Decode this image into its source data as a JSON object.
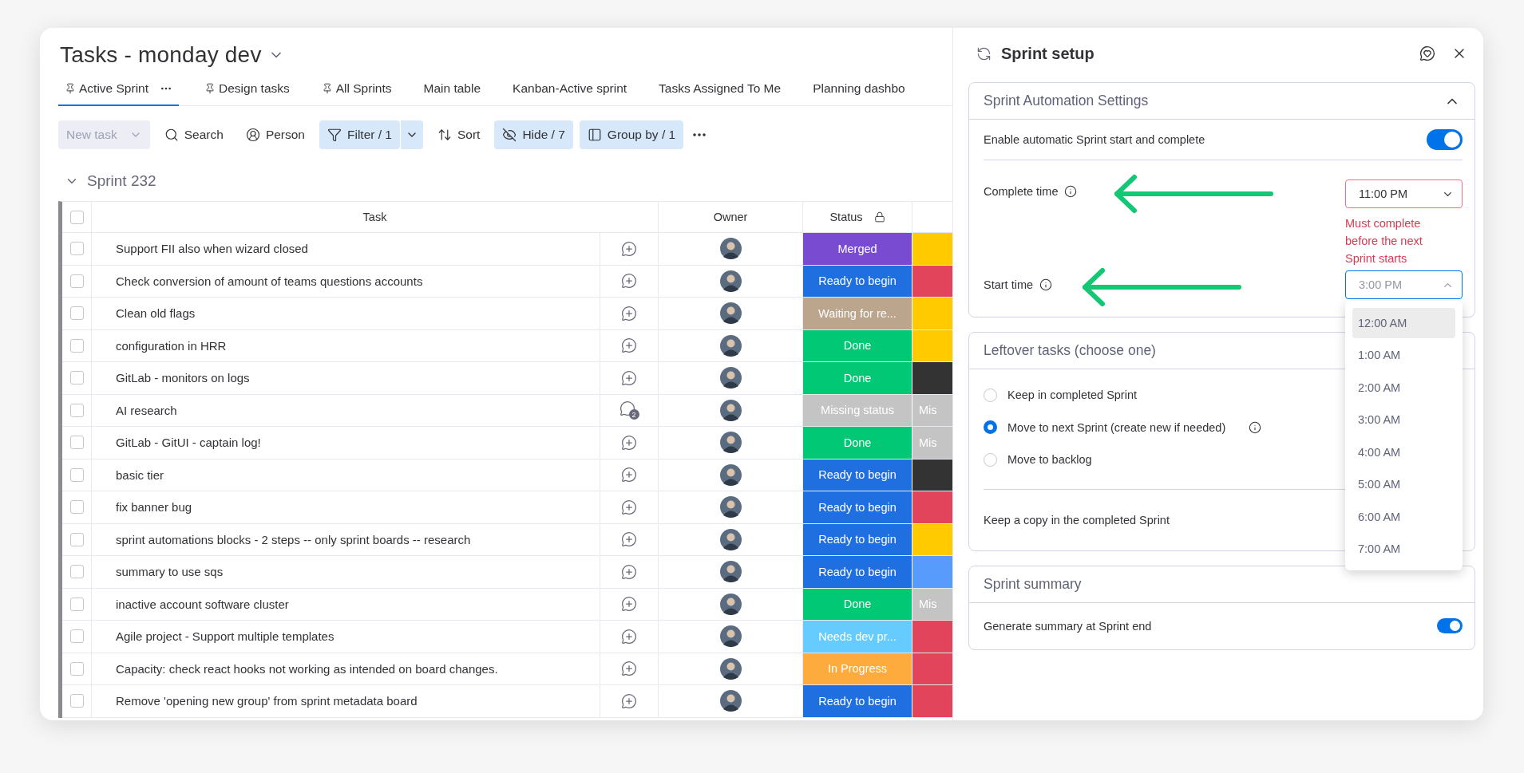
{
  "board": {
    "title": "Tasks - monday dev",
    "views": [
      {
        "label": "Active Sprint",
        "pinned": true,
        "selected": true
      },
      {
        "label": "Design tasks",
        "pinned": true,
        "selected": false
      },
      {
        "label": "All Sprints",
        "pinned": true,
        "selected": false
      },
      {
        "label": "Main table",
        "pinned": false,
        "selected": false
      },
      {
        "label": "Kanban-Active sprint",
        "pinned": false,
        "selected": false
      },
      {
        "label": "Tasks Assigned To Me",
        "pinned": false,
        "selected": false
      },
      {
        "label": "Planning dashbo",
        "pinned": false,
        "selected": false
      }
    ],
    "toolbar": [
      {
        "kind": "new",
        "label": "New task",
        "disabled": true
      },
      {
        "kind": "search",
        "label": "Search",
        "active": false
      },
      {
        "kind": "person",
        "label": "Person",
        "active": false
      },
      {
        "kind": "filter",
        "label": "Filter / 1",
        "active": true
      },
      {
        "kind": "sort",
        "label": "Sort",
        "active": false
      },
      {
        "kind": "hide",
        "label": "Hide / 7",
        "active": true
      },
      {
        "kind": "group",
        "label": "Group by / 1",
        "active": true
      },
      {
        "kind": "more"
      }
    ],
    "group": {
      "title": "Sprint 232",
      "expanded": true
    },
    "table": {
      "columns": [
        {
          "label": "Task",
          "locked": false
        },
        {
          "label": "Owner",
          "locked": false
        },
        {
          "label": "Status",
          "locked": true
        }
      ],
      "all_checked": false,
      "rows": [
        {
          "task": "Support FII also when wizard closed",
          "checked": false,
          "status": {
            "label": "Merged",
            "color": "#784bd1"
          },
          "column_5": {
            "color": "#ffcb00"
          }
        },
        {
          "task": "Check conversion of amount of teams questions accounts",
          "checked": false,
          "status": {
            "label": "Ready to begin",
            "color": "#1f6fe0"
          },
          "column_5": {
            "color": "#e2445c"
          }
        },
        {
          "task": "Clean old flags",
          "checked": false,
          "status": {
            "label": "Waiting for re...",
            "color": "#bba58d"
          },
          "column_5": {
            "color": "#ffcb00"
          }
        },
        {
          "task": "configuration in HRR",
          "checked": false,
          "status": {
            "label": "Done",
            "color": "#00c875"
          },
          "column_5": {
            "color": "#ffcb00"
          }
        },
        {
          "task": "GitLab - monitors on logs",
          "checked": false,
          "status": {
            "label": "Done",
            "color": "#00c875"
          },
          "column_5": {
            "color": "#333333"
          }
        },
        {
          "task": "AI research",
          "checked": false,
          "comments": "2",
          "status": {
            "label": "Missing status",
            "color": "#c4c4c4"
          },
          "column_5": {
            "color": "#c4c4c4",
            "text": "Mis"
          }
        },
        {
          "task": "GitLab - GitUI - captain log!",
          "checked": false,
          "status": {
            "label": "Done",
            "color": "#00c875"
          },
          "column_5": {
            "color": "#c4c4c4",
            "text": "Mis"
          }
        },
        {
          "task": "basic tier",
          "checked": false,
          "status": {
            "label": "Ready to begin",
            "color": "#1f6fe0"
          },
          "column_5": {
            "color": "#333333"
          }
        },
        {
          "task": "fix banner bug",
          "checked": false,
          "status": {
            "label": "Ready to begin",
            "color": "#1f6fe0"
          },
          "column_5": {
            "color": "#e2445c"
          }
        },
        {
          "task": "sprint automations blocks - 2 steps -- only sprint boards -- research",
          "checked": false,
          "status": {
            "label": "Ready to begin",
            "color": "#1f6fe0"
          },
          "column_5": {
            "color": "#ffcb00"
          }
        },
        {
          "task": "summary to use sqs",
          "checked": false,
          "status": {
            "label": "Ready to begin",
            "color": "#1f6fe0"
          },
          "column_5": {
            "color": "#579bfc"
          }
        },
        {
          "task": "inactive account software cluster",
          "checked": false,
          "status": {
            "label": "Done",
            "color": "#00c875"
          },
          "column_5": {
            "color": "#c4c4c4",
            "text": "Mis"
          }
        },
        {
          "task": "Agile project - Support multiple templates",
          "checked": false,
          "status": {
            "label": "Needs dev pr...",
            "color": "#66ccff"
          },
          "column_5": {
            "color": "#e2445c"
          }
        },
        {
          "task": "Capacity: check react hooks not working as intended on board changes.",
          "checked": false,
          "status": {
            "label": "In Progress",
            "color": "#fdab3d"
          },
          "column_5": {
            "color": "#e2445c"
          }
        },
        {
          "task": "Remove 'opening new group' from sprint metadata board",
          "checked": false,
          "status": {
            "label": "Ready to begin",
            "color": "#1f6fe0"
          },
          "column_5": {
            "color": "#e2445c"
          }
        }
      ]
    }
  },
  "sprint_setup": {
    "title": "Sprint setup",
    "automation": {
      "title": "Sprint Automation Settings",
      "expanded": true,
      "enable": {
        "label": "Enable automatic Sprint start and complete",
        "on": true
      },
      "complete_time": {
        "label": "Complete time",
        "value": "11:00 PM",
        "open": false,
        "error": "Must complete before the next Sprint starts"
      },
      "start_time": {
        "label": "Start time",
        "value": "3:00 PM",
        "open": true,
        "options": [
          {
            "label": "12:00 AM",
            "selected": true
          },
          {
            "label": "1:00 AM",
            "selected": false
          },
          {
            "label": "2:00 AM",
            "selected": false
          },
          {
            "label": "3:00 AM",
            "selected": false
          },
          {
            "label": "4:00 AM",
            "selected": false
          },
          {
            "label": "5:00 AM",
            "selected": false
          },
          {
            "label": "6:00 AM",
            "selected": false
          },
          {
            "label": "7:00 AM",
            "selected": false
          }
        ]
      }
    },
    "leftover": {
      "title": "Leftover tasks (choose one)",
      "options": [
        {
          "label": "Keep in completed Sprint",
          "selected": false,
          "info": false
        },
        {
          "label": "Move to next Sprint (create new if needed)",
          "selected": true,
          "info": true
        },
        {
          "label": "Move to backlog",
          "selected": false,
          "info": false
        }
      ],
      "keep_copy": {
        "label": "Keep a copy in the completed Sprint"
      }
    },
    "summary": {
      "title": "Sprint summary",
      "generate": {
        "label": "Generate summary at Sprint end",
        "on": true
      }
    }
  }
}
